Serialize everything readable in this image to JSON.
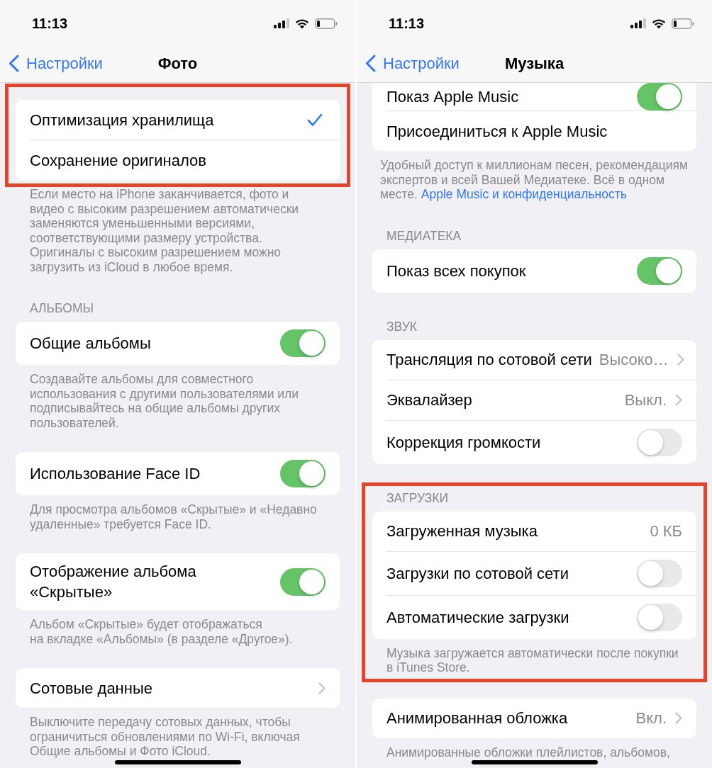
{
  "panels": [
    {
      "status_bar": {
        "time": "11:13"
      },
      "nav": {
        "back": "Настройки",
        "title": "Фото"
      },
      "scrolled": false,
      "sections": [
        {
          "highlighted": true,
          "rows": [
            {
              "kind": "check",
              "label": "Оптимизация хранилища",
              "selected": true
            },
            {
              "kind": "check",
              "label": "Сохранение оригиналов",
              "selected": false
            }
          ],
          "footer": {
            "text": "Если место на iPhone заканчивается, фото и видео с высоким разрешением автоматически заменяются уменьшенными версиями, соответствующими размеру устройства. Оригиналы с высоким разрешением можно загрузить из iCloud в любое время."
          }
        },
        {
          "header": "АЛЬБОМЫ",
          "highlighted": false,
          "rows": [
            {
              "kind": "toggle",
              "label": "Общие альбомы",
              "on": true
            }
          ],
          "footer": {
            "text": "Создавайте альбомы для совместного использования с другими пользователями или подписывайтесь на общие альбомы других пользователей."
          }
        },
        {
          "highlighted": false,
          "rows": [
            {
              "kind": "toggle",
              "label": "Использование Face ID",
              "on": true
            }
          ],
          "footer": {
            "text": "Для просмотра альбомов «Скрытые» и «Недавно удаленные» требуется Face ID."
          }
        },
        {
          "highlighted": false,
          "rows": [
            {
              "kind": "toggle",
              "label": "Отображение альбома «Скрытые»",
              "on": true
            }
          ],
          "footer": {
            "text": "Альбом «Скрытые» будет отображаться\nна вкладке «Альбомы» (в разделе «Другое»)."
          }
        },
        {
          "highlighted": false,
          "rows": [
            {
              "kind": "nav",
              "label": "Сотовые данные"
            }
          ],
          "footer": {
            "text": "Выключите передачу сотовых данных, чтобы ограничиться обновлениями по Wi-Fi, включая Общие альбомы и Фото iCloud."
          }
        }
      ]
    },
    {
      "status_bar": {
        "time": "11:13"
      },
      "nav": {
        "back": "Настройки",
        "title": "Музыка"
      },
      "scrolled": true,
      "sections": [
        {
          "highlighted": false,
          "rows": [
            {
              "kind": "toggle",
              "label": "Показ Apple Music",
              "on": true
            },
            {
              "kind": "link",
              "label": "Присоединиться к Apple Music"
            }
          ],
          "footer": {
            "text": "Удобный доступ к миллионам песен, рекомендациям экспертов и всей Вашей Медиатеке. Всё в одном месте.",
            "link": "Apple Music и конфиденциальность"
          }
        },
        {
          "header": "МЕДИАТЕКА",
          "highlighted": false,
          "rows": [
            {
              "kind": "toggle",
              "label": "Показ всех покупок",
              "on": true
            }
          ]
        },
        {
          "header": "ЗВУК",
          "highlighted": false,
          "rows": [
            {
              "kind": "nav",
              "label": "Трансляция по сотовой сети",
              "value": "Высоко…"
            },
            {
              "kind": "nav",
              "label": "Эквалайзер",
              "value": "Выкл."
            },
            {
              "kind": "toggle",
              "label": "Коррекция громкости",
              "on": false
            }
          ]
        },
        {
          "header": "ЗАГРУЗКИ",
          "highlighted": true,
          "rows": [
            {
              "kind": "value",
              "label": "Загруженная музыка",
              "value": "0 КБ"
            },
            {
              "kind": "toggle",
              "label": "Загрузки по сотовой сети",
              "on": false
            },
            {
              "kind": "toggle",
              "label": "Автоматические загрузки",
              "on": false
            }
          ],
          "footer": {
            "text": "Музыка загружается автоматически после покупки в iTunes Store."
          }
        },
        {
          "highlighted": false,
          "rows": [
            {
              "kind": "nav",
              "label": "Анимированная обложка",
              "value": "Вкл."
            }
          ],
          "footer": {
            "text": "Анимированные обложки плейлистов, альбомов,"
          }
        }
      ]
    }
  ]
}
